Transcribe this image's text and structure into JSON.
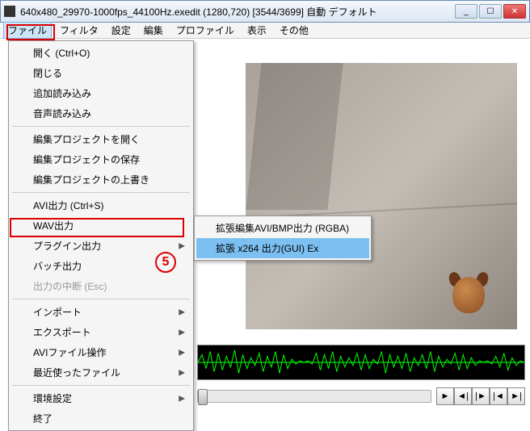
{
  "window": {
    "title": "640x480_29970-1000fps_44100Hz.exedit (1280,720)  [3544/3699]  自動  デフォルト"
  },
  "menubar": {
    "items": [
      "ファイル",
      "フィルタ",
      "設定",
      "編集",
      "プロファイル",
      "表示",
      "その他"
    ]
  },
  "file_menu": {
    "open": "開く (Ctrl+O)",
    "close": "閉じる",
    "append": "追加読み込み",
    "audio_load": "音声読み込み",
    "open_project": "編集プロジェクトを開く",
    "save_project": "編集プロジェクトの保存",
    "overwrite_project": "編集プロジェクトの上書き",
    "avi_out": "AVI出力 (Ctrl+S)",
    "wav_out": "WAV出力",
    "plugin_out": "プラグイン出力",
    "batch_out": "バッチ出力",
    "abort_out": "出力の中断 (Esc)",
    "import": "インポート",
    "export": "エクスポート",
    "avi_ops": "AVIファイル操作",
    "recent": "最近使ったファイル",
    "env": "環境設定",
    "exit": "終了"
  },
  "submenu": {
    "avi_bmp": "拡張編集AVI/BMP出力 (RGBA)",
    "x264": "拡張 x264 出力(GUI) Ex"
  },
  "annotation": {
    "circle_number": "5"
  },
  "win_controls": {
    "min": "_",
    "max": "☐",
    "close": "✕"
  },
  "transport": {
    "play": "►",
    "step_back": "◄|",
    "play_solid": "|►",
    "first": "|◄",
    "last": "►|"
  }
}
